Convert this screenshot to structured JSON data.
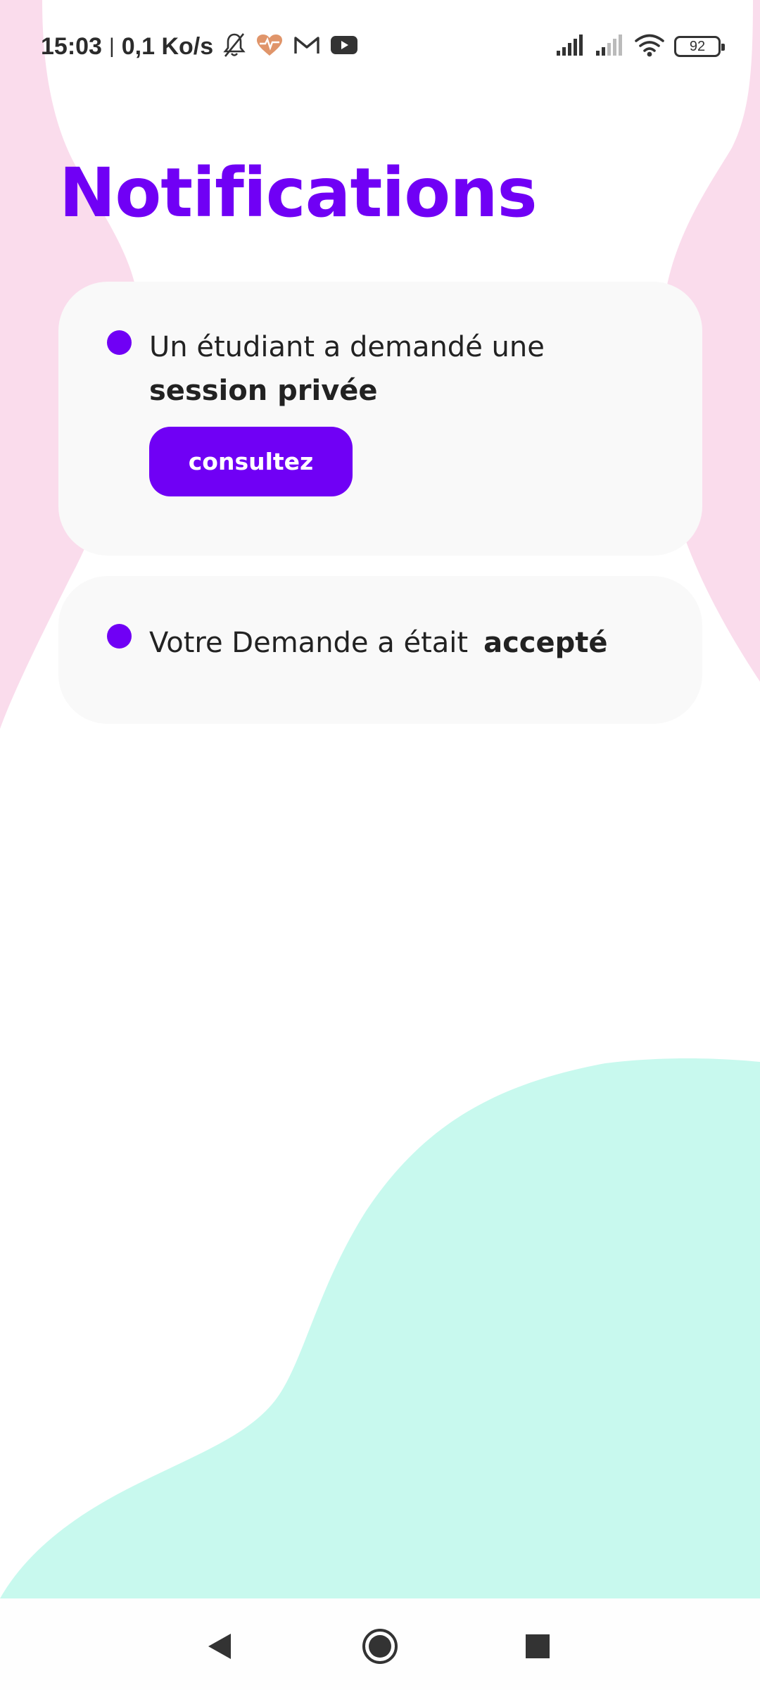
{
  "colors": {
    "accent": "#7000f5",
    "card_background": "#f9f9f9",
    "blob_pink": "#fadcec",
    "blob_mint": "#c8f9ee",
    "text_dark": "#222222"
  },
  "status_bar": {
    "time": "15:03",
    "separator": "|",
    "network_speed": "0,1 Ko/s",
    "left_icons": [
      "bell-off-icon",
      "heart-pulse-icon",
      "gmail-icon",
      "youtube-icon"
    ],
    "right_icons": [
      "signal-icon",
      "signal-weak-icon",
      "wifi-icon",
      "battery-icon"
    ],
    "battery_level": "92"
  },
  "page": {
    "title": "Notifications"
  },
  "notifications": [
    {
      "text": "Un étudiant a demandé une",
      "emphasis": "session privée",
      "action_label": "consultez"
    },
    {
      "text": "Votre Demande a était",
      "emphasis": "accepté"
    }
  ],
  "nav_bar": {
    "icons": [
      "back-icon",
      "home-icon",
      "recent-apps-icon"
    ]
  }
}
